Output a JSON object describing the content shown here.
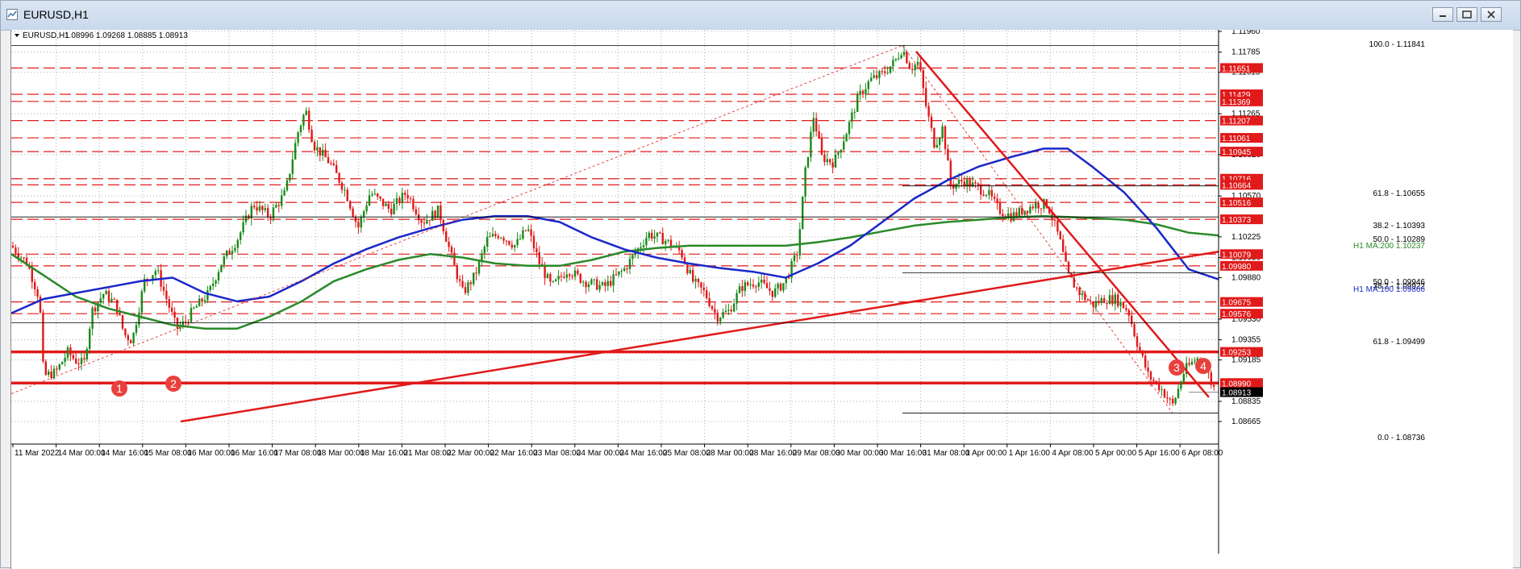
{
  "window": {
    "title": "EURUSD,H1"
  },
  "header": {
    "symbol": "EURUSD,H1",
    "ohlc": "1.08996 1.09268 1.08885 1.08913"
  },
  "colors": {
    "up": "#1a8a1a",
    "down": "#e0191a",
    "ma_blue": "#1a28c8",
    "ma_green": "#2a8a2a",
    "level": "#e01a1a",
    "fib": "#000000"
  },
  "price_axis": {
    "labels": [
      "1.11960",
      "1.11785",
      "1.11615",
      "1.11265",
      "1.10920",
      "1.10570",
      "1.10225",
      "1.10050",
      "1.09880",
      "1.09530",
      "1.09355",
      "1.09185",
      "1.08835",
      "1.08665"
    ]
  },
  "time_axis": {
    "labels": [
      "11 Mar 2022",
      "14 Mar 00:00",
      "14 Mar 16:00",
      "15 Mar 08:00",
      "16 Mar 00:00",
      "16 Mar 16:00",
      "17 Mar 08:00",
      "18 Mar 00:00",
      "18 Mar 16:00",
      "21 Mar 08:00",
      "22 Mar 00:00",
      "22 Mar 16:00",
      "23 Mar 08:00",
      "24 Mar 00:00",
      "24 Mar 16:00",
      "25 Mar 08:00",
      "28 Mar 00:00",
      "28 Mar 16:00",
      "29 Mar 08:00",
      "30 Mar 00:00",
      "30 Mar 16:00",
      "31 Mar 08:00",
      "1 Apr 00:00",
      "1 Apr 16:00",
      "4 Apr 08:00",
      "5 Apr 00:00",
      "5 Apr 16:00",
      "6 Apr 08:00"
    ]
  },
  "level_boxes": [
    {
      "text": "1.11651",
      "price": 1.11651
    },
    {
      "text": "1.11429",
      "price": 1.11429
    },
    {
      "text": "1.11369",
      "price": 1.11369
    },
    {
      "text": "1.11207",
      "price": 1.11207
    },
    {
      "text": "1.11061",
      "price": 1.11061
    },
    {
      "text": "1.10945",
      "price": 1.10945
    },
    {
      "text": "1.10716",
      "price": 1.10716
    },
    {
      "text": "1.10664",
      "price": 1.10664
    },
    {
      "text": "1.10516",
      "price": 1.10516
    },
    {
      "text": "1.10373",
      "price": 1.10373
    },
    {
      "text": "1.10079",
      "price": 1.10079
    },
    {
      "text": "1.09980",
      "price": 1.0998
    },
    {
      "text": "1.09675",
      "price": 1.09675
    },
    {
      "text": "1.09576",
      "price": 1.09576
    },
    {
      "text": "1.09253",
      "price": 1.09253
    },
    {
      "text": "1.08990",
      "price": 1.0899
    }
  ],
  "current_price": {
    "text": "1.08913",
    "price": 1.08913
  },
  "fib_labels": {
    "f100": "100.0 - 1.11841",
    "f618a": "61.8 - 1.10655",
    "f382a": "38.2 - 1.10393",
    "f500": "50.0 - 1.10289",
    "f500b": "50.0 - 1.09946",
    "f382b": "38.2 - 1.09922",
    "f618b": "61.8 - 1.09499",
    "f0": "0.0 - 1.08736",
    "ma200": "H1 MA:200 1.10237",
    "ma100": "H1 MA:100 1.09866"
  },
  "circle_markers": [
    "1",
    "2",
    "3",
    "4"
  ]
}
